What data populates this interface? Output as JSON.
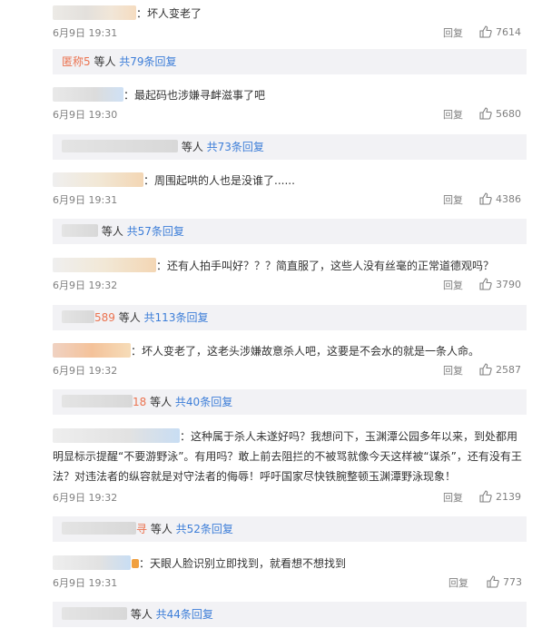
{
  "reply_label": "回复",
  "comments": [
    {
      "text": "：坏人变老了",
      "date": "6月9日 19:31",
      "likes": "7614",
      "sub": {
        "prefix": "匿称5",
        "who": " 等人",
        "count": " 共79条回复"
      }
    },
    {
      "text": "：最起码也涉嫌寻衅滋事了吧",
      "date": "6月9日 19:30",
      "likes": "5680",
      "sub": {
        "prefix": "",
        "who": " 等人",
        "count": " 共73条回复"
      }
    },
    {
      "text": "：周围起哄的人也是没谁了......",
      "date": "6月9日 19:31",
      "likes": "4386",
      "sub": {
        "prefix": "",
        "who": " 等人",
        "count": " 共57条回复"
      }
    },
    {
      "text": "：还有人拍手叫好？？？简直服了，这些人没有丝毫的正常道德观吗？",
      "date": "6月9日 19:32",
      "likes": "3790",
      "sub": {
        "prefix": "589",
        "who": " 等人",
        "count": " 共113条回复"
      }
    },
    {
      "text": "：坏人变老了，这老头涉嫌故意杀人吧，这要是不会水的就是一条人命。",
      "date": "6月9日 19:32",
      "likes": "2587",
      "sub": {
        "prefix": "18",
        "who": " 等人",
        "count": " 共40条回复"
      }
    },
    {
      "text_lines": [
        "：这种属于杀人未遂好吗？我想问下，玉渊潭公园多年以来，到处都用",
        "明显标示提醒“不要游野泳”。有用吗？敢上前去阻拦的不被骂就像今天这样被“谋杀”，还有没有王",
        "法？对违法者的纵容就是对守法者的侮辱！呼吁国家尽快铁腕整顿玉渊潭野泳现象！"
      ],
      "date": "6月9日 19:32",
      "likes": "2139",
      "sub": {
        "prefix": "寻",
        "who": " 等人",
        "count": " 共52条回复"
      }
    },
    {
      "text": "：天眼人脸识别立即找到，就看想不想找到",
      "date": "6月9日 19:31",
      "likes": "773",
      "sub": {
        "prefix": "",
        "who": " 等人",
        "count": " 共44条回复"
      }
    }
  ]
}
